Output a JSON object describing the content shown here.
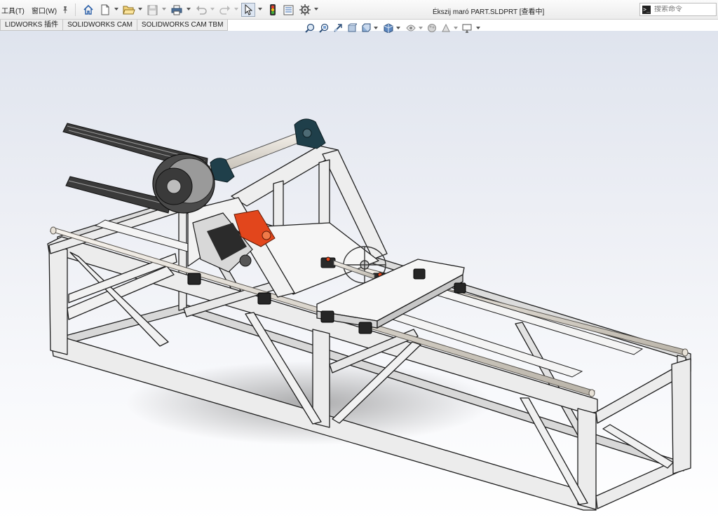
{
  "menu": {
    "tools_label": "工具(T)",
    "window_label": "窗口(W)"
  },
  "toolbar": {
    "icons": [
      "pin-icon",
      "home-icon",
      "new-document-icon",
      "open-icon",
      "save-icon",
      "print-icon",
      "undo-icon",
      "redo-icon",
      "select-icon",
      "rebuild-icon",
      "file-properties-icon",
      "options-icon"
    ]
  },
  "window": {
    "title": "Ékszij maró PART.SLDPRT [查看中]"
  },
  "search": {
    "placeholder": "搜索命令"
  },
  "tabs": [
    {
      "label": "LIDWORKS 插件"
    },
    {
      "label": "SOLIDWORKS CAM"
    },
    {
      "label": "SOLIDWORKS CAM TBM"
    }
  ],
  "view_toolbar": {
    "icons": [
      "zoom-to-fit-icon",
      "zoom-area-icon",
      "previous-view-icon",
      "section-view-icon",
      "view-orientation-icon",
      "display-style-icon",
      "hide-show-items-icon",
      "edit-appearance-icon",
      "apply-scene-icon",
      "view-settings-icon"
    ]
  },
  "colors": {
    "frame": "#e9e9e9",
    "edge": "#1f1f1f",
    "motor_accent": "#e2461c",
    "bearing_housing": "#1f3f4a"
  }
}
